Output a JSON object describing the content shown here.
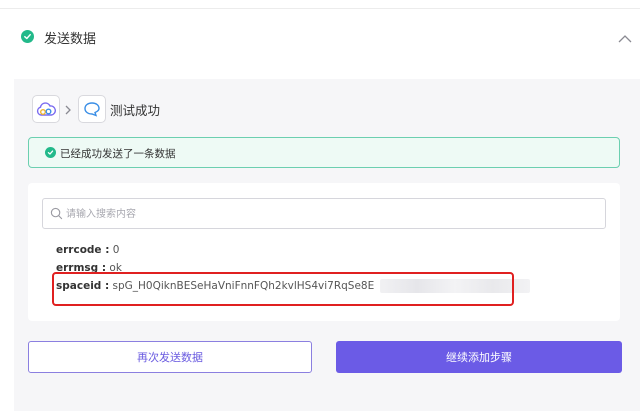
{
  "header": {
    "title": "发送数据",
    "status_icon": "check-circle-icon",
    "toggle_icon": "chevron-up-icon",
    "accent_color": "#22b98a"
  },
  "steps": {
    "app_icon": "cloud-app-icon",
    "separator_icon": "chevron-right-icon",
    "action_icon": "chat-action-icon",
    "title": "测试成功"
  },
  "banner": {
    "text": "已经成功发送了一条数据",
    "icon": "check-circle-icon",
    "color": "#22b98a"
  },
  "search": {
    "placeholder": "请输入搜索内容",
    "value": "",
    "icon": "search-icon"
  },
  "result": {
    "errcode": {
      "key": "errcode :",
      "value": "0"
    },
    "errmsg": {
      "key": "errmsg :",
      "value": "ok"
    },
    "spaceid": {
      "key": "spaceid :",
      "value": "spG_H0QiknBESeHaVniFnnFQh2kvlHS4vi7RqSe8E"
    },
    "highlight_color": "#e02020"
  },
  "buttons": {
    "resend": "再次发送数据",
    "continue": "继续添加步骤",
    "primary_color": "#6b5be6"
  }
}
